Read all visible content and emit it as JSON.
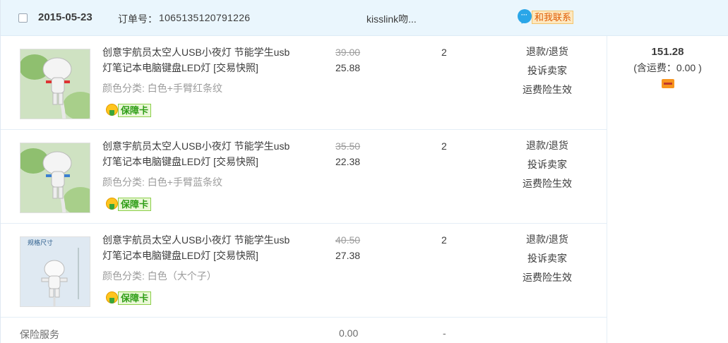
{
  "order": {
    "date": "2015-05-23",
    "order_no_label": "订单号：",
    "order_no": "1065135120791226",
    "seller": "kisslink吻...",
    "contact_label": "和我联系",
    "total": "151.28",
    "shipping_note": "(含运费：0.00 )",
    "payment_icon": "card-icon"
  },
  "items": [
    {
      "title": "创意宇航员太空人USB小夜灯 节能学生usb灯笔记本电脑键盘LED灯 [交易快照]",
      "sku": "颜色分类: 白色+手臂红条纹",
      "badge": "保障卡",
      "orig_price": "39.00",
      "price": "25.88",
      "qty": "2",
      "actions": [
        "退款/退货",
        "投诉卖家",
        "运费险生效"
      ]
    },
    {
      "title": "创意宇航员太空人USB小夜灯 节能学生usb灯笔记本电脑键盘LED灯 [交易快照]",
      "sku": "颜色分类: 白色+手臂蓝条纹",
      "badge": "保障卡",
      "orig_price": "35.50",
      "price": "22.38",
      "qty": "2",
      "actions": [
        "退款/退货",
        "投诉卖家",
        "运费险生效"
      ]
    },
    {
      "title": "创意宇航员太空人USB小夜灯 节能学生usb灯笔记本电脑键盘LED灯 [交易快照]",
      "sku": "颜色分类: 白色（大个子）",
      "badge": "保障卡",
      "orig_price": "40.50",
      "price": "27.38",
      "qty": "2",
      "actions": [
        "退款/退货",
        "投诉卖家",
        "运费险生效"
      ],
      "thumb_caption": "规格尺寸"
    }
  ],
  "insurance": {
    "label": "保险服务",
    "value": "0.00",
    "dash": "-"
  },
  "colors": {
    "header_bg": "#eaf6fd",
    "contact_text": "#e05a00",
    "badge_green": "#2f9e17"
  }
}
